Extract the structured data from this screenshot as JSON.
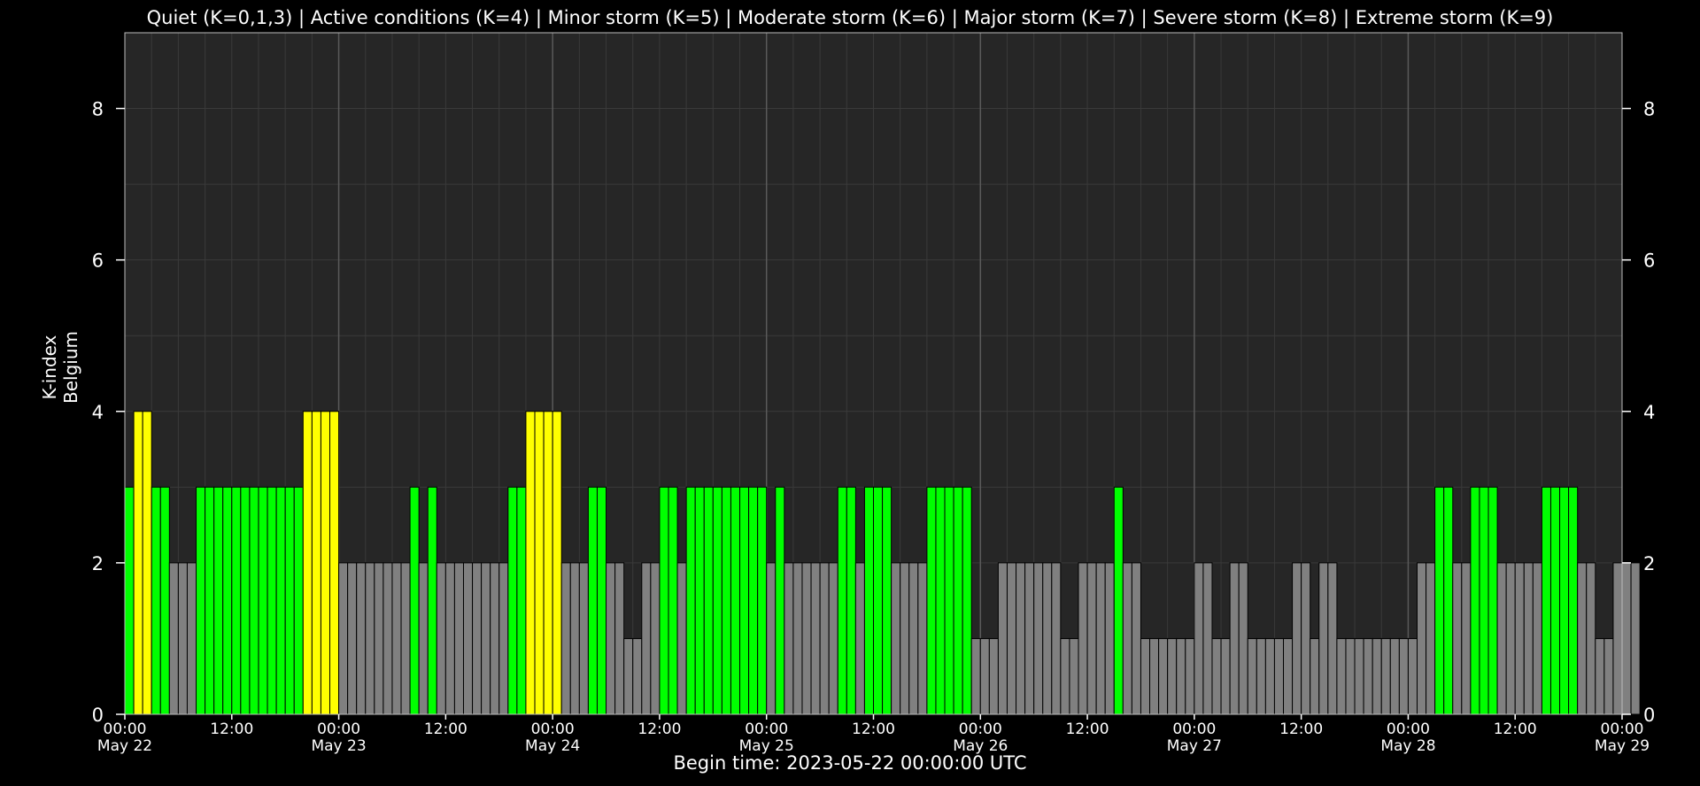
{
  "chart_data": {
    "type": "bar",
    "title": "Quiet (K=0,1,3) | Active conditions (K=4) | Minor storm (K=5) | Moderate storm (K=6) | Major storm (K=7) | Severe storm (K=8) | Extreme storm (K=9)",
    "ylabel_lines": [
      "K-index",
      "Belgium"
    ],
    "footer": "Begin time: 2023-05-22 00:00:00 UTC",
    "ylim": [
      0,
      9
    ],
    "yticks": [
      0,
      2,
      4,
      6,
      8
    ],
    "xlim_hours": [
      0,
      168
    ],
    "xticks": [
      {
        "time": "00:00",
        "date": "May 22"
      },
      {
        "time": "12:00",
        "date": ""
      },
      {
        "time": "00:00",
        "date": "May 23"
      },
      {
        "time": "12:00",
        "date": ""
      },
      {
        "time": "00:00",
        "date": "May 24"
      },
      {
        "time": "12:00",
        "date": ""
      },
      {
        "time": "00:00",
        "date": "May 25"
      },
      {
        "time": "12:00",
        "date": ""
      },
      {
        "time": "00:00",
        "date": "May 26"
      },
      {
        "time": "12:00",
        "date": ""
      },
      {
        "time": "00:00",
        "date": "May 27"
      },
      {
        "time": "12:00",
        "date": ""
      },
      {
        "time": "00:00",
        "date": "May 28"
      },
      {
        "time": "12:00",
        "date": ""
      },
      {
        "time": "00:00",
        "date": "May 29"
      }
    ],
    "grid": true,
    "bar_interval_minutes": 60,
    "values": [
      3,
      4,
      4,
      3,
      3,
      2,
      2,
      2,
      3,
      3,
      3,
      3,
      3,
      3,
      3,
      3,
      3,
      3,
      3,
      3,
      4,
      4,
      4,
      4,
      2,
      2,
      2,
      2,
      2,
      2,
      2,
      2,
      3,
      2,
      3,
      2,
      2,
      2,
      2,
      2,
      2,
      2,
      2,
      3,
      3,
      4,
      4,
      4,
      4,
      2,
      2,
      2,
      3,
      3,
      2,
      2,
      1,
      1,
      2,
      2,
      3,
      3,
      2,
      3,
      3,
      3,
      3,
      3,
      3,
      3,
      3,
      3,
      2,
      3,
      2,
      2,
      2,
      2,
      2,
      2,
      3,
      3,
      2,
      3,
      3,
      3,
      2,
      2,
      2,
      2,
      3,
      3,
      3,
      3,
      3,
      1,
      1,
      1,
      2,
      2,
      2,
      2,
      2,
      2,
      2,
      1,
      1,
      2,
      2,
      2,
      2,
      3,
      2,
      2,
      1,
      1,
      1,
      1,
      1,
      1,
      2,
      2,
      1,
      1,
      2,
      2,
      1,
      1,
      1,
      1,
      1,
      2,
      2,
      1,
      2,
      2,
      1,
      1,
      1,
      1,
      1,
      1,
      1,
      1,
      1,
      2,
      2,
      3,
      3,
      2,
      2,
      3,
      3,
      3,
      2,
      2,
      2,
      2,
      2,
      3,
      3,
      3,
      3,
      2,
      2,
      1,
      1,
      2,
      2,
      2
    ],
    "colors": {
      "quiet_low": "#808080",
      "quiet": "#00ff00",
      "active": "#ffff00",
      "plot_background": "#262626",
      "page_background": "#000000",
      "grid": "#3a3a3a",
      "day_divider": "#5a5a5a"
    }
  }
}
